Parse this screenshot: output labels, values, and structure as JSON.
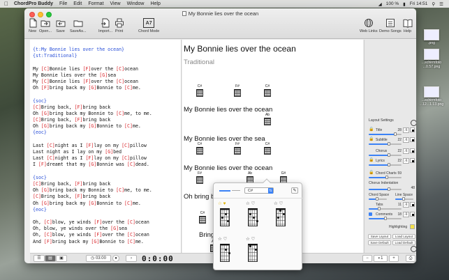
{
  "menubar": {
    "app_name": "ChordPro Buddy",
    "items": [
      "File",
      "Edit",
      "Format",
      "View",
      "Window",
      "Help"
    ],
    "battery": "100 %",
    "clock": "Fri 14:51"
  },
  "window": {
    "title": "My Bonnie lies over the ocean"
  },
  "toolbar": {
    "new": "New",
    "open": "Open...",
    "save": "Save",
    "save_as": "SaveAs...",
    "import": "Import...",
    "print": "Print",
    "chord_mode": "Chord Mode",
    "chord_mode_glyph": "A7",
    "web_links": "Web Links",
    "demo_songs": "Demo Songs",
    "help": "Help"
  },
  "source_lines": [
    [
      {
        "t": "{t:My Bonnie lies over the ocean}",
        "c": "dir"
      }
    ],
    [
      {
        "t": "{st:Traditional}",
        "c": "dir"
      }
    ],
    [],
    [
      {
        "t": "My "
      },
      {
        "t": "[C]",
        "c": "ch"
      },
      {
        "t": "Bonnie lies "
      },
      {
        "t": "[F]",
        "c": "ch"
      },
      {
        "t": "over the "
      },
      {
        "t": "[C]",
        "c": "ch"
      },
      {
        "t": "ocean"
      }
    ],
    [
      {
        "t": "My Bonnie lies over the "
      },
      {
        "t": "[G]",
        "c": "ch"
      },
      {
        "t": "sea"
      }
    ],
    [
      {
        "t": "My "
      },
      {
        "t": "[C]",
        "c": "ch"
      },
      {
        "t": "Bonnie lies "
      },
      {
        "t": "[F]",
        "c": "ch"
      },
      {
        "t": "over the "
      },
      {
        "t": "[C]",
        "c": "ch"
      },
      {
        "t": "ocean"
      }
    ],
    [
      {
        "t": "Oh "
      },
      {
        "t": "[F]",
        "c": "ch"
      },
      {
        "t": "bring back my "
      },
      {
        "t": "[G]",
        "c": "ch"
      },
      {
        "t": "Bonnie to "
      },
      {
        "t": "[C]",
        "c": "ch"
      },
      {
        "t": "me."
      }
    ],
    [],
    [
      {
        "t": "{soc}",
        "c": "dir"
      }
    ],
    [
      {
        "t": "[C]",
        "c": "ch"
      },
      {
        "t": "Bring back, "
      },
      {
        "t": "[F]",
        "c": "ch"
      },
      {
        "t": "bring back"
      }
    ],
    [
      {
        "t": "Oh "
      },
      {
        "t": "[G]",
        "c": "ch"
      },
      {
        "t": "bring back my Bonnie to "
      },
      {
        "t": "[C]",
        "c": "ch"
      },
      {
        "t": "me, to me."
      }
    ],
    [
      {
        "t": "[C]",
        "c": "ch"
      },
      {
        "t": "Bring back, "
      },
      {
        "t": "[F]",
        "c": "ch"
      },
      {
        "t": "bring back"
      }
    ],
    [
      {
        "t": "Oh "
      },
      {
        "t": "[G]",
        "c": "ch"
      },
      {
        "t": "bring back my "
      },
      {
        "t": "[G]",
        "c": "ch"
      },
      {
        "t": "Bonnie to "
      },
      {
        "t": "[C]",
        "c": "ch"
      },
      {
        "t": "me."
      }
    ],
    [
      {
        "t": "{eoc}",
        "c": "dir"
      }
    ],
    [],
    [
      {
        "t": "Last "
      },
      {
        "t": "[C]",
        "c": "ch"
      },
      {
        "t": "night as I "
      },
      {
        "t": "[F]",
        "c": "ch"
      },
      {
        "t": "lay on my "
      },
      {
        "t": "[C]",
        "c": "ch"
      },
      {
        "t": "pillow"
      }
    ],
    [
      {
        "t": "Last night as I lay on my "
      },
      {
        "t": "[G]",
        "c": "ch"
      },
      {
        "t": "bed"
      }
    ],
    [
      {
        "t": "Last "
      },
      {
        "t": "[C]",
        "c": "ch"
      },
      {
        "t": "night as I "
      },
      {
        "t": "[F]",
        "c": "ch"
      },
      {
        "t": "lay on my "
      },
      {
        "t": "[C]",
        "c": "ch"
      },
      {
        "t": "pillow"
      }
    ],
    [
      {
        "t": "I "
      },
      {
        "t": "[F]",
        "c": "ch"
      },
      {
        "t": "dreamt that my "
      },
      {
        "t": "[G]",
        "c": "ch"
      },
      {
        "t": "Bonnie was "
      },
      {
        "t": "[C]",
        "c": "ch"
      },
      {
        "t": "dead."
      }
    ],
    [],
    [
      {
        "t": "{soc}",
        "c": "dir"
      }
    ],
    [
      {
        "t": "[C]",
        "c": "ch"
      },
      {
        "t": "Bring back, "
      },
      {
        "t": "[F]",
        "c": "ch"
      },
      {
        "t": "bring back"
      }
    ],
    [
      {
        "t": "Oh "
      },
      {
        "t": "[G]",
        "c": "ch"
      },
      {
        "t": "bring back my Bonnie to "
      },
      {
        "t": "[C]",
        "c": "ch"
      },
      {
        "t": "me, to me."
      }
    ],
    [
      {
        "t": "[C]",
        "c": "ch"
      },
      {
        "t": "Bring back, "
      },
      {
        "t": "[F]",
        "c": "ch"
      },
      {
        "t": "bring back"
      }
    ],
    [
      {
        "t": "Oh "
      },
      {
        "t": "[G]",
        "c": "ch"
      },
      {
        "t": "bring back my "
      },
      {
        "t": "[G]",
        "c": "ch"
      },
      {
        "t": "Bonnie to "
      },
      {
        "t": "[C]",
        "c": "ch"
      },
      {
        "t": "me."
      }
    ],
    [
      {
        "t": "{eoc}",
        "c": "dir"
      }
    ],
    [],
    [
      {
        "t": "Oh, "
      },
      {
        "t": "[C]",
        "c": "ch"
      },
      {
        "t": "blow, ye winds "
      },
      {
        "t": "[F]",
        "c": "ch"
      },
      {
        "t": "over the "
      },
      {
        "t": "[C]",
        "c": "ch"
      },
      {
        "t": "ocean"
      }
    ],
    [
      {
        "t": "Oh, blow, ye winds over the "
      },
      {
        "t": "[G]",
        "c": "ch"
      },
      {
        "t": "sea"
      }
    ],
    [
      {
        "t": "Oh, "
      },
      {
        "t": "[C]",
        "c": "ch"
      },
      {
        "t": "blow, ye winds "
      },
      {
        "t": "[F]",
        "c": "ch"
      },
      {
        "t": "over the "
      },
      {
        "t": "[C]",
        "c": "ch"
      },
      {
        "t": "ocean"
      }
    ],
    [
      {
        "t": "And "
      },
      {
        "t": "[F]",
        "c": "ch"
      },
      {
        "t": "bring back my "
      },
      {
        "t": "[G]",
        "c": "ch"
      },
      {
        "t": "Bonnie to "
      },
      {
        "t": "[C]",
        "c": "ch"
      },
      {
        "t": "me."
      }
    ]
  ],
  "preview": {
    "title": "My Bonnie lies over the ocean",
    "subtitle": "Traditional",
    "lines": [
      "My Bonnie lies over the ocean",
      "My Bonnie lies over the sea",
      "My Bonnie lies over the ocean",
      "Oh bring back m",
      "Bring back,"
    ],
    "chord_names": [
      "C#",
      "F#",
      "C#",
      "Ab",
      "C#",
      "F#",
      "C#",
      "F#",
      "Ab",
      "G#",
      "C#",
      "Ab"
    ]
  },
  "popover": {
    "selected_chord": "C#",
    "stars": [
      "☆ ♥",
      "☆ ♡",
      "☆ ♡",
      "☆ ♡",
      "☆ ♡"
    ]
  },
  "settings": {
    "header": "Layout Settings",
    "rows": [
      {
        "label": "Title",
        "value": "28",
        "level": 0.8
      },
      {
        "label": "Subtitle",
        "value": "22",
        "level": 0.62
      },
      {
        "label": "Chorus",
        "value": "22",
        "level": 0.62
      },
      {
        "label": "Lyrics",
        "value": "22",
        "level": 0.62
      },
      {
        "label": "Chord Charts",
        "value": "59",
        "level": 0.55
      }
    ],
    "chorus_indent_label": "Chorus Indentation",
    "chorus_indent_value": "48",
    "chord_space_label": "Chord Space",
    "line_space_label": "Line Space",
    "tabs_label": "Tabs",
    "tabs_value": "11",
    "comments_label": "Comments",
    "comments_value": "18",
    "highlighting_label": "Highlighting",
    "highlight_color": "#f4e04a",
    "btn_save_layout": "Save Layout",
    "btn_load_layout": "Load Layout",
    "btn_save_default": "Save Default",
    "btn_load_default": "Load Default"
  },
  "bottombar": {
    "time": "03:00",
    "big_timer": "0:0:00",
    "zoom_value": "1"
  },
  "desktop": {
    "icons": [
      ".png",
      "...schirmfoto ...0.57.png",
      "...schirmfoto ...12...1.13.png"
    ]
  },
  "colors": {
    "chord_red": "#d8262b",
    "directive_blue": "#2a50d8",
    "accent_blue": "#3b82f6"
  }
}
